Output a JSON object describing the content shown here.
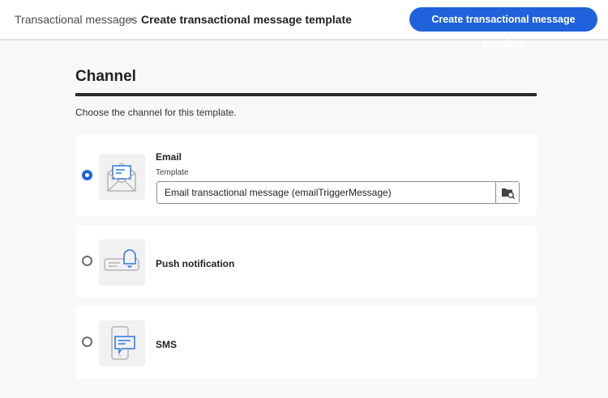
{
  "header": {
    "breadcrumb": [
      "Transactional messages",
      "Create transactional message template"
    ],
    "separator": "›",
    "action_button": "Create transactional message template"
  },
  "section": {
    "title": "Channel",
    "description": "Choose the channel for this template."
  },
  "channels": [
    {
      "label": "Email",
      "selected": true,
      "template_label": "Template",
      "template_value": "Email transactional message (emailTriggerMessage)"
    },
    {
      "label": "Push notification",
      "selected": false
    },
    {
      "label": "SMS",
      "selected": false
    }
  ],
  "colors": {
    "accent": "#1f62dc"
  }
}
